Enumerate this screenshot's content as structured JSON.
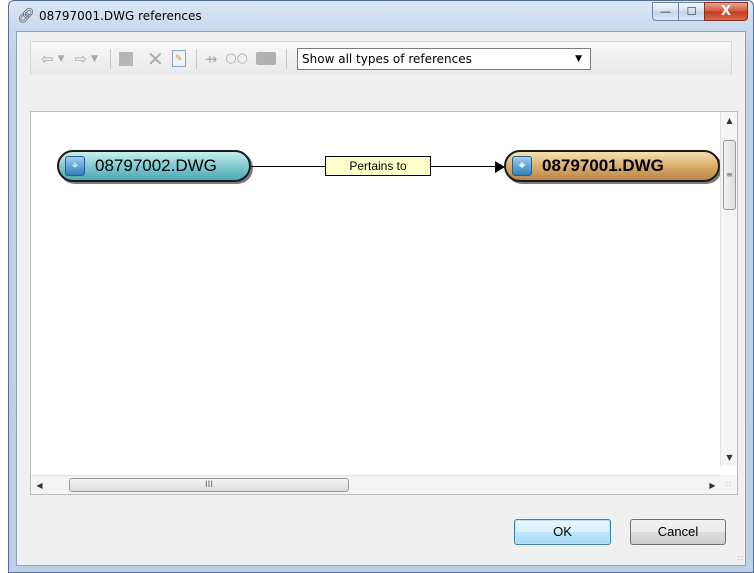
{
  "window": {
    "title": "08797001.DWG references",
    "title_icon": "link-icon",
    "controls": {
      "minimize": "—",
      "maximize": "☐",
      "close": "X"
    }
  },
  "toolbar": {
    "icons": [
      "back-arrow-icon",
      "back-dropdown-icon",
      "forward-arrow-icon",
      "forward-dropdown-icon",
      "open-document-icon",
      "delete-icon",
      "properties-icon",
      "expand-icon",
      "view-glasses-icon",
      "book-icon"
    ],
    "filter_select": {
      "value": "Show all types of references"
    }
  },
  "graph": {
    "nodes": [
      {
        "id": "src",
        "label": "08797002.DWG"
      },
      {
        "id": "dst",
        "label": "08797001.DWG"
      }
    ],
    "edge_label": "Pertains to"
  },
  "scrollbars": {
    "hthumb_glyph": "III",
    "vthumb_glyph": "≡"
  },
  "buttons": {
    "ok": "OK",
    "cancel": "Cancel"
  },
  "colors": {
    "source_node": "#7cc6cc",
    "target_node": "#d7aa66",
    "edge_label_bg": "#ffffcc"
  }
}
